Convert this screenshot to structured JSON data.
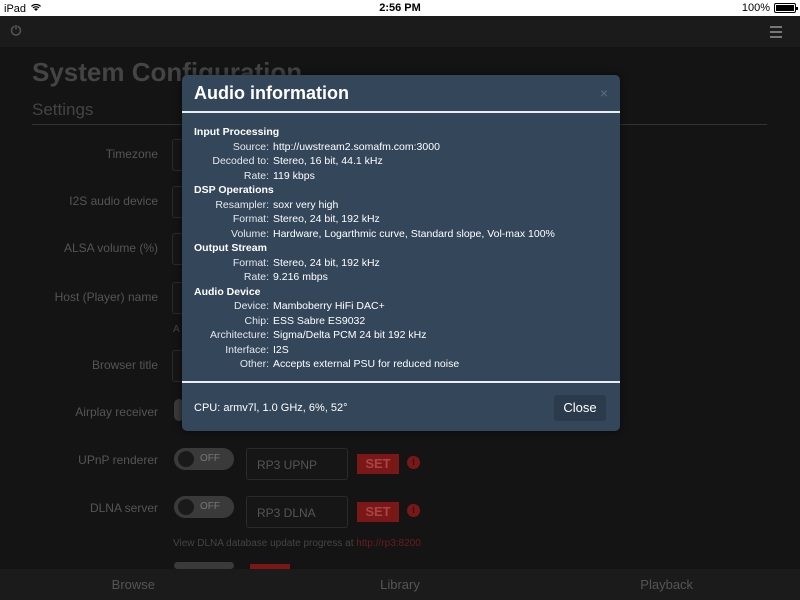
{
  "statusbar": {
    "device": "iPad",
    "time": "2:56 PM",
    "battery": "100%",
    "battery_level": 1.0
  },
  "page": {
    "title": "System Configuration",
    "section": "Settings",
    "rows": [
      {
        "label": "Timezone"
      },
      {
        "label": "I2S audio device"
      },
      {
        "label": "ALSA volume (%)"
      },
      {
        "label": "Host (Player) name"
      },
      {
        "label": "Browser title"
      },
      {
        "label": "Airplay receiver"
      },
      {
        "label": "UPnP renderer",
        "toggle": "OFF",
        "field": "RP3 UPNP",
        "set": "SET"
      },
      {
        "label": "DLNA server",
        "toggle": "OFF",
        "field": "RP3 DLNA",
        "set": "SET"
      }
    ],
    "host_note_fragment": "A",
    "dlna_note": "View DLNA database update progress at ",
    "dlna_link": "http://rp3:8200"
  },
  "bottomnav": [
    "Browse",
    "Library",
    "Playback"
  ],
  "modal": {
    "title": "Audio information",
    "close_x": "×",
    "groups": [
      {
        "title": "Input Processing",
        "items": [
          {
            "k": "Source:",
            "v": "http://uwstream2.somafm.com:3000"
          },
          {
            "k": "Decoded to:",
            "v": "Stereo, 16 bit, 44.1 kHz"
          },
          {
            "k": "Rate:",
            "v": "119 kbps"
          }
        ]
      },
      {
        "title": "DSP Operations",
        "items": [
          {
            "k": "Resampler:",
            "v": "soxr very high"
          },
          {
            "k": "Format:",
            "v": "Stereo, 24 bit, 192 kHz"
          },
          {
            "k": "Volume:",
            "v": "Hardware, Logarthmic curve, Standard slope, Vol-max 100%"
          }
        ]
      },
      {
        "title": "Output Stream",
        "items": [
          {
            "k": "Format:",
            "v": "Stereo, 24 bit, 192 kHz"
          },
          {
            "k": "Rate:",
            "v": "9.216 mbps"
          }
        ]
      },
      {
        "title": "Audio Device",
        "items": [
          {
            "k": "Device:",
            "v": "Mamboberry HiFi DAC+"
          },
          {
            "k": "Chip:",
            "v": "ESS Sabre ES9032"
          },
          {
            "k": "Architecture:",
            "v": "Sigma/Delta PCM 24 bit 192 kHz"
          },
          {
            "k": "Interface:",
            "v": "I2S"
          },
          {
            "k": "Other:",
            "v": "Accepts external PSU for reduced noise"
          }
        ]
      }
    ],
    "cpu": "CPU: armv7l, 1.0 GHz, 6%, 52°",
    "close_label": "Close"
  }
}
